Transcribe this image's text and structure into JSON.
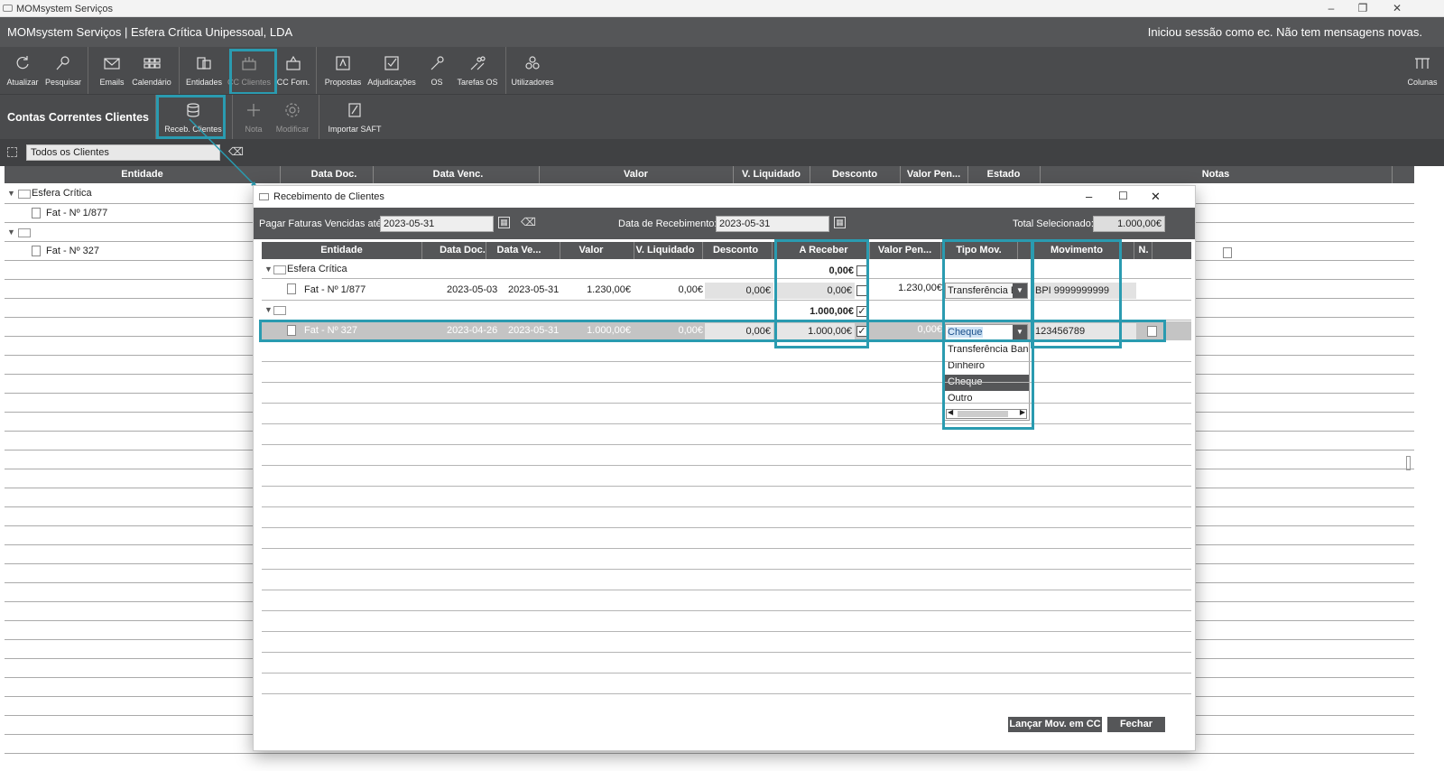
{
  "os": {
    "title": "MOMsystem Serviços"
  },
  "header": {
    "app_title": "MOMsystem Serviços | Esfera Crítica Unipessoal, LDA",
    "session": "Iniciou sessão como ec. Não tem mensagens novas."
  },
  "toolbar": {
    "atualizar": "Atualizar",
    "pesquisar": "Pesquisar",
    "emails": "Emails",
    "calendario": "Calendário",
    "entidades": "Entidades",
    "cc_clientes": "CC Clientes",
    "cc_forn": "CC Forn.",
    "propostas": "Propostas",
    "adjudicacoes": "Adjudicações",
    "os": "OS",
    "tarefas_os": "Tarefas OS",
    "utilizadores": "Utilizadores",
    "colunas": "Colunas"
  },
  "subbar": {
    "section_title": "Contas Correntes Clientes",
    "receb": "Receb. Clientes",
    "nota": "Nota",
    "modificar": "Modificar",
    "importar": "Importar SAFT"
  },
  "filter": {
    "value": "Todos os Clientes"
  },
  "main_grid": {
    "columns": [
      "Entidade",
      "Data Doc.",
      "Data Venc.",
      "Valor",
      "V. Liquidado",
      "Desconto",
      "Valor Pen...",
      "Estado",
      "Notas"
    ],
    "group1": "Esfera Crítica",
    "row1": "Fat - Nº 1/877",
    "group2": "",
    "row2": "Fat - Nº 327"
  },
  "dialog": {
    "title": "Recebimento de Clientes",
    "pagar_label": "Pagar Faturas Vencidas até:",
    "pagar_value": "2023-05-31",
    "data_receb_label": "Data de Recebimento:",
    "data_receb_value": "2023-05-31",
    "total_label": "Total Selecionado:",
    "total_value": "1.000,00€",
    "columns": [
      "Entidade",
      "Data Doc.",
      "Data Ve...",
      "Valor",
      "V. Liquidado",
      "Desconto",
      "A Receber",
      "Valor Pen...",
      "Tipo Mov.",
      "Movimento",
      "N."
    ],
    "group1": {
      "name": "Esfera Crítica",
      "a_receber": "0,00€"
    },
    "row1": {
      "entidade": "Fat - Nº 1/877",
      "data_doc": "2023-05-03",
      "data_venc": "2023-05-31",
      "valor": "1.230,00€",
      "v_liq": "0,00€",
      "desconto": "0,00€",
      "a_receber": "0,00€",
      "valor_pen": "1.230,00€",
      "tipo": "Transferência Ba",
      "movimento": "BPI 9999999999"
    },
    "group2": {
      "name": "",
      "a_receber": "1.000,00€"
    },
    "row2": {
      "entidade": "Fat - Nº 327",
      "data_doc": "2023-04-26",
      "data_venc": "2023-05-31",
      "valor": "1.000,00€",
      "v_liq": "0,00€",
      "desconto": "0,00€",
      "a_receber": "1.000,00€",
      "valor_pen": "0,00€",
      "tipo": "Cheque",
      "movimento": "123456789"
    },
    "dropdown_options": [
      "Transferência Bancária",
      "Dinheiro",
      "Cheque",
      "Outro"
    ],
    "btn_lancar": "Lançar Mov. em CC",
    "btn_fechar": "Fechar"
  },
  "colors": {
    "accent": "#2a9bb0",
    "toolbar_bg": "#4a4b4d",
    "header_bg": "#555658"
  }
}
